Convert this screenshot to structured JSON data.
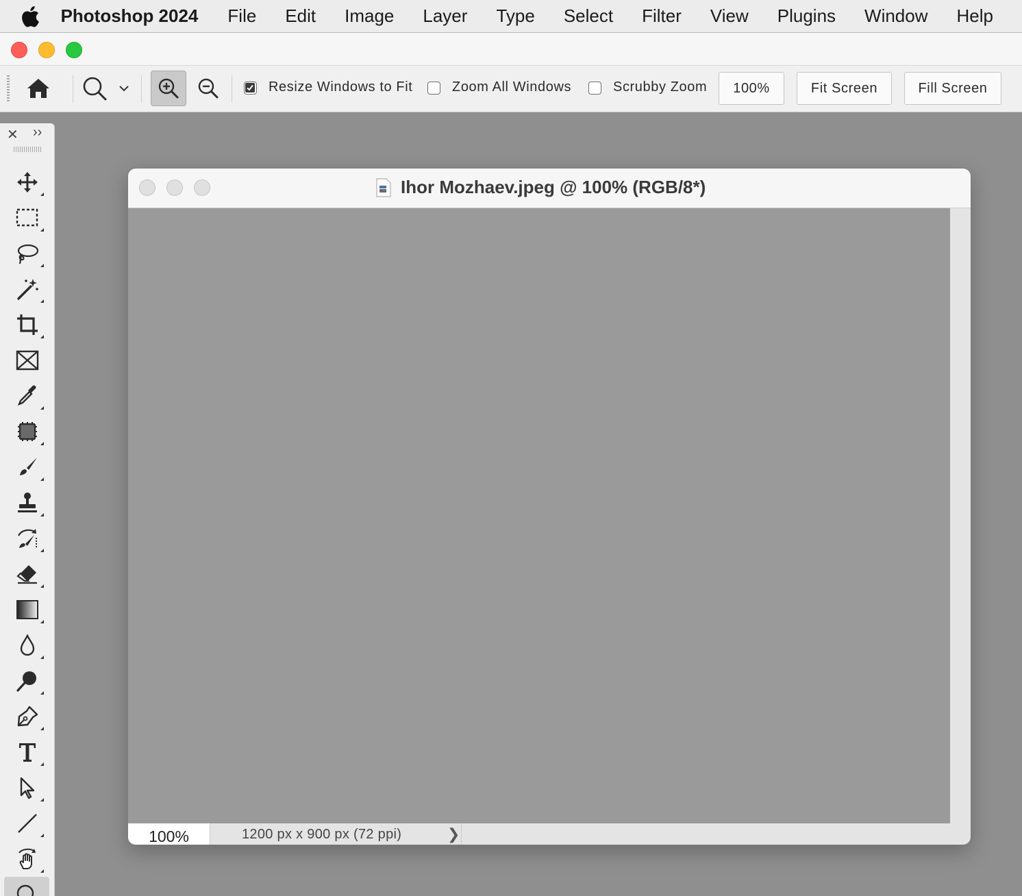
{
  "menubar": {
    "app_name": "Photoshop 2024",
    "items": [
      "File",
      "Edit",
      "Image",
      "Layer",
      "Type",
      "Select",
      "Filter",
      "View",
      "Plugins",
      "Window",
      "Help"
    ]
  },
  "options_bar": {
    "resize_windows_label": "Resize Windows to Fit",
    "resize_windows_checked": true,
    "zoom_all_label": "Zoom All Windows",
    "zoom_all_checked": false,
    "scrubby_label": "Scrubby Zoom",
    "scrubby_checked": false,
    "zoom_value": "100%",
    "fit_screen_label": "Fit Screen",
    "fill_screen_label": "Fill Screen"
  },
  "document": {
    "title": "Ihor Mozhaev.jpeg @ 100% (RGB/8*)",
    "zoom": "100%",
    "info": "1200 px x 900 px (72 ppi)",
    "info_arrow": "❯"
  },
  "toolbar": {
    "close_glyph": "✕",
    "expand_glyph": "››",
    "tools": [
      "move-tool",
      "marquee-tool",
      "lasso-tool",
      "magic-wand-tool",
      "crop-tool",
      "frame-tool",
      "eyedropper-tool",
      "patch-tool",
      "brush-tool",
      "clone-stamp-tool",
      "history-brush-tool",
      "eraser-tool",
      "gradient-tool",
      "blur-tool",
      "dodge-tool",
      "pen-tool",
      "type-tool",
      "path-selection-tool",
      "line-tool",
      "hand-tool",
      "zoom-tool"
    ],
    "active_tool": "zoom-tool"
  },
  "colors": {
    "close": "#fe5f57",
    "minimize": "#febc2e",
    "maximize": "#28c840",
    "workspace": "#8f8f8f",
    "canvas": "#9a9a9a"
  }
}
